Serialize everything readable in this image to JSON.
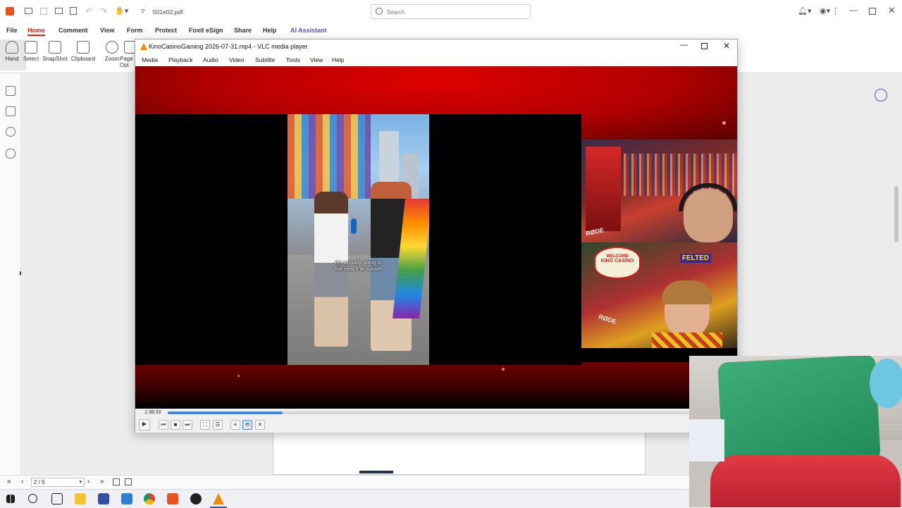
{
  "foxit": {
    "filename": "S01e02.pdf",
    "search_placeholder": "Search",
    "menu": [
      "File",
      "Home",
      "Comment",
      "View",
      "Form",
      "Protect",
      "Foxit eSign",
      "Share",
      "Help",
      "AI Assistant"
    ],
    "ribbon": [
      "Hand",
      "Select",
      "SnapShot",
      "Clipboard",
      "Zoom",
      "Page Opt"
    ],
    "page_indicator": "2 / 5"
  },
  "vlc": {
    "title": "KinoCasinoGaming 2026-07-31.mp4 - VLC media player",
    "menu": [
      "Media",
      "Playback",
      "Audio",
      "Video",
      "Subtitle",
      "Tools",
      "View",
      "Help"
    ],
    "elapsed": "1:38:33",
    "progress": 0.22,
    "caption_line1": "I'm actually going to",
    "caption_line2": "the beach at sunset",
    "rode_label": "RØDE",
    "sign_welcome": "WELCOME",
    "sign_name": "KINO CASINO",
    "sign_felted": "FELTED"
  },
  "colors": {
    "vlc_progress": "#3b8ad9",
    "stage_red": "#c40000",
    "ai_accent": "#5a4fcf",
    "home_accent": "#d9230f"
  }
}
